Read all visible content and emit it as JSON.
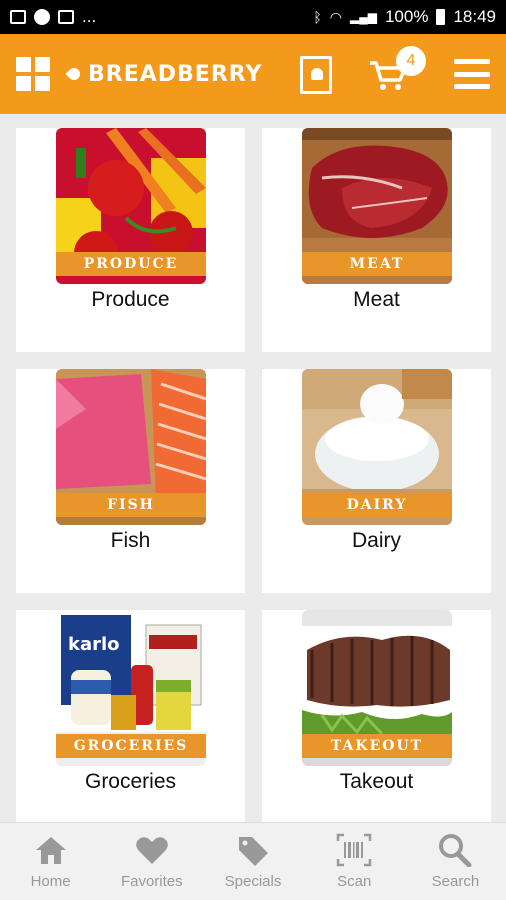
{
  "status_bar": {
    "left_icons": [
      "image-icon",
      "chat-bubble-icon",
      "photo-icon"
    ],
    "ellipsis": "...",
    "battery": "100%",
    "time": "18:49"
  },
  "header": {
    "brand": "BREADBERRY",
    "cart_count": "4",
    "accent_color": "#f39a1d"
  },
  "categories": [
    {
      "ribbon": "PRODUCE",
      "label": "Produce"
    },
    {
      "ribbon": "MEAT",
      "label": "Meat"
    },
    {
      "ribbon": "FISH",
      "label": "Fish"
    },
    {
      "ribbon": "DAIRY",
      "label": "Dairy"
    },
    {
      "ribbon": "GROCERIES",
      "label": "Groceries"
    },
    {
      "ribbon": "TAKEOUT",
      "label": "Takeout"
    }
  ],
  "tabbar": {
    "items": [
      {
        "label": "Home",
        "icon": "home-icon"
      },
      {
        "label": "Favorites",
        "icon": "heart-icon"
      },
      {
        "label": "Specials",
        "icon": "tag-icon"
      },
      {
        "label": "Scan",
        "icon": "barcode-icon"
      },
      {
        "label": "Search",
        "icon": "search-icon"
      }
    ]
  }
}
